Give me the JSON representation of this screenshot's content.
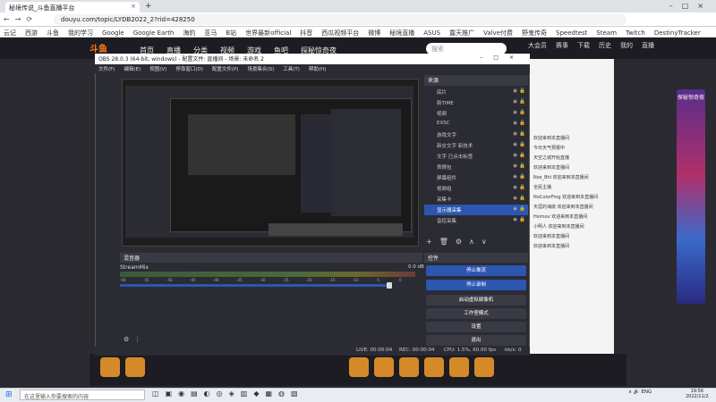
{
  "browser": {
    "tab_title": "秘境传说_斗鱼直播平台",
    "url": "douyu.com/topic/LYDB2022_2?rid=428250",
    "bookmarks": [
      "云记",
      "西游",
      "斗鱼",
      "我的学习",
      "Google",
      "Google Earth",
      "海豹",
      "亚马",
      "B站",
      "世界最新official",
      "抖音",
      "西瓜视频平台",
      "微博",
      "秘境直播",
      "ASUS",
      "露天推广",
      "Valve付费",
      "野鬼传奇",
      "Speedtest",
      "Steam",
      "Twitch",
      "DestinyTracker"
    ]
  },
  "douyu": {
    "nav": [
      "首页",
      "直播",
      "分类",
      "视频",
      "游戏",
      "鱼吧",
      "探秘惊奇夜"
    ],
    "search_placeholder": "搜索",
    "header_icons": [
      "大会员",
      "赛事",
      "下载",
      "历史",
      "我的",
      "直播"
    ],
    "chat": [
      "欢迎来到本直播间",
      "今日天气预报中",
      "天空之城开始直播",
      "欢迎来到本直播间",
      "Nox_Bhi 欢迎来到本直播间",
      "全民主播",
      "NoColorFrog 欢迎来到本直播间",
      "天涯的海底 欢迎来到本直播间",
      "Hsimov 欢迎来到本直播间",
      "小明人 欢迎来到本直播间",
      "欢迎来到本直播间",
      "欢迎来到本直播间"
    ],
    "ad_title": "探秘惊奇夜"
  },
  "obs": {
    "title": "OBS 28.0.3 (64-bit, windows) - 配置文件: 直播间 - 场景: 未命名 2",
    "menu": [
      "文件(F)",
      "编辑(E)",
      "视图(V)",
      "停靠窗口(D)",
      "配置文件(P)",
      "场景集合(S)",
      "工具(T)",
      "帮助(H)"
    ],
    "sources_title": "来源",
    "sources": [
      {
        "name": "底片",
        "selected": false
      },
      {
        "name": "新TIME",
        "selected": false
      },
      {
        "name": "视频",
        "selected": false
      },
      {
        "name": "EXSC",
        "selected": false
      },
      {
        "name": "游戏文字",
        "selected": false
      },
      {
        "name": "新交文字 新技术",
        "selected": false
      },
      {
        "name": "文字 已点击标签",
        "selected": false
      },
      {
        "name": "表情包",
        "selected": false
      },
      {
        "name": "屏幕组件",
        "selected": false
      },
      {
        "name": "视频组",
        "selected": false
      },
      {
        "name": "采集卡",
        "selected": false
      },
      {
        "name": "显示器采集",
        "selected": true
      },
      {
        "name": "音控采集",
        "selected": false
      }
    ],
    "mixer_title": "混音器",
    "mixer_channel": "StreamMix",
    "mixer_db": "0.0 dB",
    "mixer_scale": [
      "-60",
      "-55",
      "-50",
      "-45",
      "-40",
      "-35",
      "-30",
      "-25",
      "-20",
      "-15",
      "-10",
      "-5",
      "0"
    ],
    "controls_title": "控件",
    "controls": [
      "停止推流",
      "停止录制",
      "启动虚拟摄像机",
      "工作室模式",
      "设置",
      "退出"
    ],
    "status": {
      "live": "LIVE: 00:00:04",
      "rec": "REC: 00:00:04",
      "cpu": "CPU: 1.5%, 60.00 fps",
      "kbps": "kb/s: 0"
    }
  },
  "taskbar": {
    "search_placeholder": "在这里输入你要搜索的内容",
    "lang": "ENG",
    "time": "19:56",
    "date": "2022/11/2"
  }
}
